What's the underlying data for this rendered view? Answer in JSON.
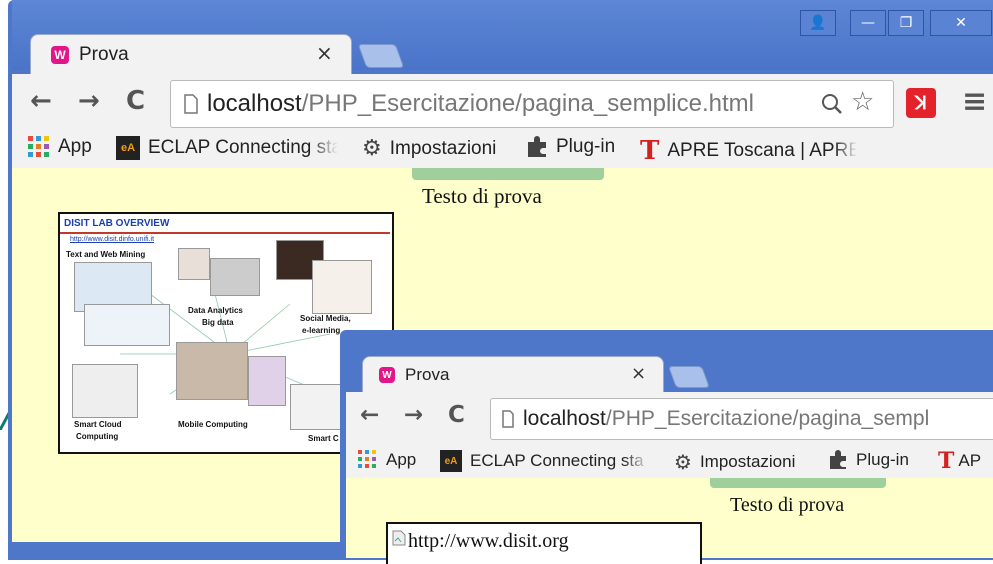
{
  "window": {
    "tab_title": "Prova",
    "tab_close": "×",
    "controls": {
      "user": "👤",
      "minimize": "—",
      "maximize": "❐",
      "close": "✕"
    }
  },
  "toolbar": {
    "back": "←",
    "forward": "→",
    "reload": "C",
    "url_host": "localhost",
    "url_path": "/PHP_Esercitazione/pagina_semplice.html",
    "menu": "≡"
  },
  "bookmarks": [
    {
      "label": "App",
      "icon": "apps-grid-icon"
    },
    {
      "label": "ECLAP Connecting sta",
      "icon": "eclap-icon"
    },
    {
      "label": "Impostazioni",
      "icon": "gear-icon"
    },
    {
      "label": "Plug-in",
      "icon": "puzzle-icon"
    },
    {
      "label": "APRE Toscana | APRE",
      "icon": "apre-t-icon"
    }
  ],
  "page": {
    "text": "Testo di prova",
    "image_title": "DISIT LAB OVERVIEW",
    "image_url": "http://www.disit.dinfo.unifi.it",
    "image_labels": [
      "Text and Web Mining",
      "Data Analytics",
      "Big data",
      "Social Media,",
      "e-learning",
      "Smart Cloud",
      "Computing",
      "Mobile Computing",
      "Smart C"
    ]
  },
  "inner_window": {
    "tab_title": "Prova",
    "tab_close": "×",
    "url_host": "localhost",
    "url_path": "/PHP_Esercitazione/pagina_sempl",
    "bookmarks": [
      {
        "label": "App"
      },
      {
        "label": "ECLAP Connecting sta"
      },
      {
        "label": "Impostazioni"
      },
      {
        "label": "Plug-in"
      },
      {
        "label": "AP"
      }
    ],
    "text": "Testo di prova",
    "broken_image_alt": "http://www.disit.org"
  },
  "colors": {
    "frame": "#4f77c9",
    "page_bg": "#ffffcc",
    "accent_green": "#9fcf9b",
    "avira_red": "#e3222b"
  }
}
